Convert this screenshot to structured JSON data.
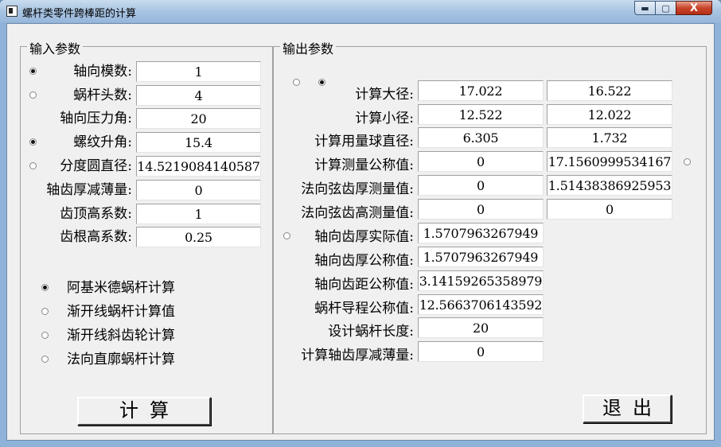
{
  "window": {
    "title": "螺杆类零件跨棒距的计算",
    "min_glyph": "▬",
    "max_glyph": "▢",
    "close_glyph": "X"
  },
  "input": {
    "legend": "输入参数",
    "rows": [
      {
        "label": "轴向模数:",
        "value": "1",
        "radio": true,
        "checked": true
      },
      {
        "label": "蜗杆头数:",
        "value": "4",
        "radio": true,
        "checked": false
      },
      {
        "label": "轴向压力角:",
        "value": "20",
        "radio": false
      },
      {
        "label": "螺纹升角:",
        "value": "15.4",
        "radio": true,
        "checked": true
      },
      {
        "label": "分度圆直径:",
        "value": "14.5219084140587",
        "radio": true,
        "checked": false
      },
      {
        "label": "轴齿厚减薄量:",
        "value": "0",
        "radio": false
      },
      {
        "label": "齿顶高系数:",
        "value": "1",
        "radio": false
      },
      {
        "label": "齿根高系数:",
        "value": "0.25",
        "radio": false
      }
    ],
    "modes": [
      {
        "label": "阿基米德蜗杆计算",
        "checked": true
      },
      {
        "label": "渐开线蜗杆计算值",
        "checked": false
      },
      {
        "label": "渐开线斜齿轮计算",
        "checked": false
      },
      {
        "label": "法向直廓蜗杆计算",
        "checked": false
      }
    ],
    "calc_button": "计算"
  },
  "output": {
    "legend": "输出参数",
    "rows": [
      {
        "label": "计算大径:",
        "v1": "17.022",
        "v2": "16.522"
      },
      {
        "label": "计算小径:",
        "v1": "12.522",
        "v2": "12.022"
      },
      {
        "label": "计算用量球直径:",
        "v1": "6.305",
        "v2": "1.732"
      },
      {
        "label": "计算测量公称值:",
        "v1": "0",
        "v2": "17.1560999534167"
      },
      {
        "label": "法向弦齿厚测量值:",
        "v1": "0",
        "v2": "1.51438386925953"
      },
      {
        "label": "法向弦齿高测量值:",
        "v1": "0",
        "v2": "0"
      },
      {
        "label": "轴向齿厚实际值:",
        "v1": "1.5707963267949"
      },
      {
        "label": "轴向齿厚公称值:",
        "v1": "1.5707963267949"
      },
      {
        "label": "轴向齿距公称值:",
        "v1": "3.14159265358979"
      },
      {
        "label": "蜗杆导程公称值:",
        "v1": "12.5663706143592"
      },
      {
        "label": "设计蜗杆长度:",
        "v1": "20"
      },
      {
        "label": "计算轴齿厚减薄量:",
        "v1": "0"
      }
    ],
    "exit_button": "退出"
  }
}
